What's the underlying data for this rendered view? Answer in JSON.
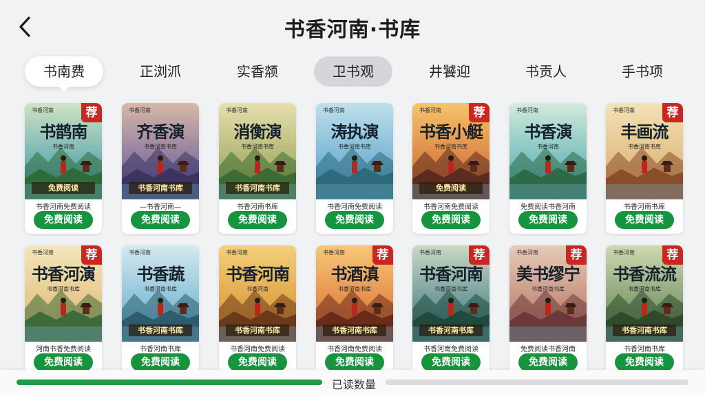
{
  "header": {
    "title": "书香河南·书库",
    "back_icon": "chevron-left-icon"
  },
  "tabs": [
    {
      "label": "书南费",
      "state": "active"
    },
    {
      "label": "正浏沠",
      "state": ""
    },
    {
      "label": "实香颒",
      "state": ""
    },
    {
      "label": "卫书观",
      "state": "selected"
    },
    {
      "label": "井饕迎",
      "state": ""
    },
    {
      "label": "书贡人",
      "state": ""
    },
    {
      "label": "手书项",
      "state": ""
    }
  ],
  "recommend_badge": "荐",
  "read_button_label": "免费阅读",
  "books": [
    {
      "title": "书鹊南",
      "pub": "书香河南",
      "sub": "书香河南",
      "band": "免费阅读",
      "caption": "书香河南免费阅读",
      "badge": true,
      "sky": "#2f8fa8",
      "sky2": "#cfe3c3",
      "hill": "#2f6b3a"
    },
    {
      "title": "齐香演",
      "pub": "书香河南",
      "sub": "书香河南书库",
      "band": "书香河南书库",
      "caption": "—书香河南—",
      "badge": false,
      "sky": "#5a4f9c",
      "sky2": "#d7b8a7",
      "hill": "#3b3461"
    },
    {
      "title": "消衡演",
      "pub": "书香河南",
      "sub": "书香河南书库",
      "band": "书香河南书库",
      "caption": "书香河南书库",
      "badge": false,
      "sky": "#8a9a4a",
      "sky2": "#e7dfae",
      "hill": "#3e6b33"
    },
    {
      "title": "涛执演",
      "pub": "书香河南",
      "sub": "书香河南书库",
      "band": "",
      "caption": "书香河南免费阅读",
      "badge": false,
      "sky": "#4a9ac4",
      "sky2": "#bfe0ec",
      "hill": "#2c6a7c"
    },
    {
      "title": "书香小艇",
      "pub": "书香河南",
      "sub": "书香河南书库",
      "band": "免费阅读",
      "caption": "书香河南免费阅读",
      "badge": true,
      "sky": "#c85a2b",
      "sky2": "#f7c46a",
      "hill": "#5a2b1e"
    },
    {
      "title": "书香演",
      "pub": "书香河南",
      "sub": "书香河南",
      "band": "",
      "caption": "免费阅读书香河南",
      "badge": false,
      "sky": "#3fa3a6",
      "sky2": "#d3ebdd",
      "hill": "#2e6a4a"
    },
    {
      "title": "丰画流",
      "pub": "书香河南",
      "sub": "书香河南书库",
      "band": "",
      "caption": "书香河南书库",
      "badge": true,
      "sky": "#d7a863",
      "sky2": "#f3e2b8",
      "hill": "#8a4d2b"
    },
    {
      "title": "书香河演",
      "pub": "书香河南",
      "sub": "书香河南书库",
      "band": "",
      "caption": "河南书香免费阅读",
      "badge": true,
      "sky": "#d9b46a",
      "sky2": "#f4e6bd",
      "hill": "#3f6a3a"
    },
    {
      "title": "书香蔬",
      "pub": "书香河南",
      "sub": "书香河南书库",
      "band": "书香河南书库",
      "caption": "书香河南书库",
      "badge": false,
      "sky": "#5aa7c9",
      "sky2": "#d3e9ef",
      "hill": "#2d5c6e"
    },
    {
      "title": "书香河南",
      "pub": "书香河南",
      "sub": "书香河南",
      "band": "书香河南书库",
      "caption": "书香河南免费阅读",
      "badge": false,
      "sky": "#d28a2a",
      "sky2": "#f4cf7a",
      "hill": "#6a3a1c"
    },
    {
      "title": "书酒滇",
      "pub": "书香河南",
      "sub": "书香河南书库",
      "band": "书香河南书库",
      "caption": "书香河南免费阅读",
      "badge": true,
      "sky": "#d9662e",
      "sky2": "#f6c777",
      "hill": "#6a2b1b"
    },
    {
      "title": "书香河南",
      "pub": "书香河南",
      "sub": "书香河南书库",
      "band": "书香河南书库",
      "caption": "书香河南免费阅读",
      "badge": true,
      "sky": "#2f6d7a",
      "sky2": "#c9d9c4",
      "hill": "#1f4a3c"
    },
    {
      "title": "美书缪宁",
      "pub": "书香河南",
      "sub": "书香河南书库",
      "band": "",
      "caption": "免费阅读书香河南",
      "badge": true,
      "sky": "#b06a5a",
      "sky2": "#e6cbb7",
      "hill": "#6a3a3a"
    },
    {
      "title": "书香流流",
      "pub": "书香河南",
      "sub": "书香河南书库",
      "band": "书香河南书库",
      "caption": "书香河南书库",
      "badge": true,
      "sky": "#567a4a",
      "sky2": "#cfd9b0",
      "hill": "#2e4a2a"
    }
  ],
  "footer": {
    "progress_label": "已读数量",
    "progress_fraction": 0.46
  }
}
